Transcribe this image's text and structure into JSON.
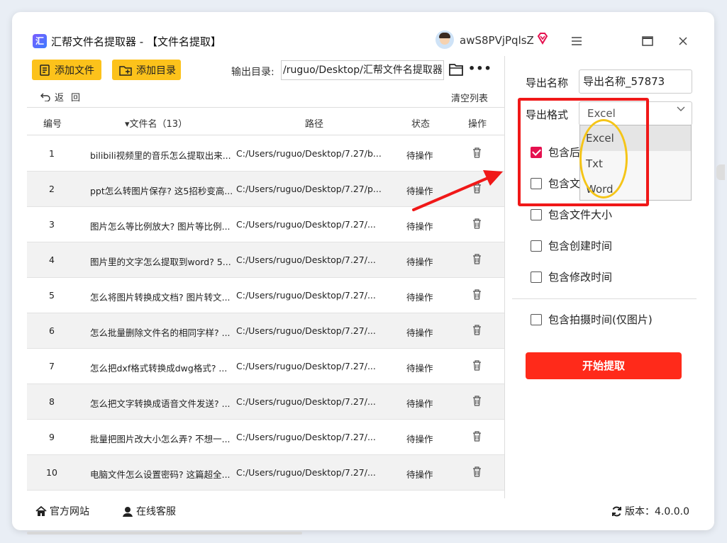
{
  "app": {
    "title": "汇帮文件名提取器 - 【文件名提取】",
    "logo_glyph": "汇",
    "username": "awS8PVjPqlsZ",
    "accent_color": "#fcc21b",
    "primary_red": "#ff2a1a"
  },
  "toolbar": {
    "add_file": "添加文件",
    "add_dir": "添加目录",
    "output_label": "输出目录:",
    "output_path": "/ruguo/Desktop/汇帮文件名提取器",
    "back": "返回",
    "clear_list": "清空列表"
  },
  "table": {
    "headers": {
      "no": "编号",
      "name": "▾文件名（13）",
      "path": "路径",
      "status": "状态",
      "op": "操作"
    },
    "rows": [
      {
        "no": "1",
        "name": "bilibili视频里的音乐怎么提取出来...",
        "path": "C:/Users/ruguo/Desktop/7.27/b...",
        "status": "待操作"
      },
      {
        "no": "2",
        "name": "ppt怎么转图片保存? 这5招秒变高...",
        "path": "C:/Users/ruguo/Desktop/7.27/p...",
        "status": "待操作"
      },
      {
        "no": "3",
        "name": "图片怎么等比例放大? 图片等比例...",
        "path": "C:/Users/ruguo/Desktop/7.27/...",
        "status": "待操作"
      },
      {
        "no": "4",
        "name": "图片里的文字怎么提取到word? 5...",
        "path": "C:/Users/ruguo/Desktop/7.27/...",
        "status": "待操作"
      },
      {
        "no": "5",
        "name": "怎么将图片转换成文档? 图片转文...",
        "path": "C:/Users/ruguo/Desktop/7.27/...",
        "status": "待操作"
      },
      {
        "no": "6",
        "name": "怎么批量删除文件名的相同字样? ...",
        "path": "C:/Users/ruguo/Desktop/7.27/...",
        "status": "待操作"
      },
      {
        "no": "7",
        "name": "怎么把dxf格式转换成dwg格式? ...",
        "path": "C:/Users/ruguo/Desktop/7.27/...",
        "status": "待操作"
      },
      {
        "no": "8",
        "name": "怎么把文字转换成语音文件发送? ...",
        "path": "C:/Users/ruguo/Desktop/7.27/...",
        "status": "待操作"
      },
      {
        "no": "9",
        "name": "批量把图片改大小怎么弄? 不想一...",
        "path": "C:/Users/ruguo/Desktop/7.27/...",
        "status": "待操作"
      },
      {
        "no": "10",
        "name": "电脑文件怎么设置密码? 这篇超全...",
        "path": "C:/Users/ruguo/Desktop/7.27/...",
        "status": "待操作"
      }
    ]
  },
  "panel": {
    "export_name_label": "导出名称",
    "export_name_value": "导出名称_57873",
    "export_format_label": "导出格式",
    "export_format_value": "Excel",
    "format_options": [
      "Excel",
      "Txt",
      "Word"
    ],
    "checkboxes": [
      {
        "label": "包含后",
        "checked": true
      },
      {
        "label": "包含文",
        "checked": false
      },
      {
        "label": "包含文件大小",
        "checked": false
      },
      {
        "label": "包含创建时间",
        "checked": false
      },
      {
        "label": "包含修改时间",
        "checked": false
      },
      {
        "label": "包含拍摄时间(仅图片)",
        "checked": false
      }
    ],
    "start_button": "开始提取"
  },
  "footer": {
    "site": "官方网站",
    "service": "在线客服",
    "version": "版本：4.0.0.0"
  }
}
